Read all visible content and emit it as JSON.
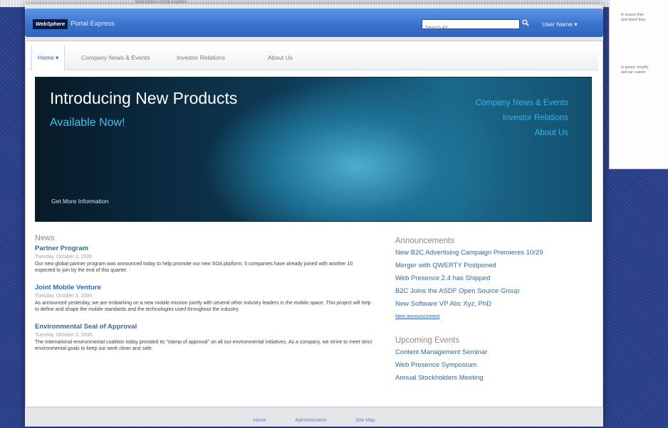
{
  "portal": {
    "brand_logo": "WebSphere",
    "brand_name": "Portal Express",
    "search_placeholder": "Search All",
    "search_icon": "search-icon",
    "user_menu": "User Name ▾"
  },
  "nav": {
    "tabs": [
      {
        "label": "Home ▾"
      },
      {
        "label": "Company News & Events"
      },
      {
        "label": "Investor Relations"
      },
      {
        "label": "About Us"
      }
    ]
  },
  "hero": {
    "title": "Introducing New Products",
    "subtitle": "Available Now!",
    "links": [
      "Company News & Events",
      "Investor Relations",
      "About Us"
    ],
    "cta": "Get More Information"
  },
  "news": {
    "title": "News",
    "items": [
      {
        "headline": "Partner Program",
        "date": "Tuesday, October 3, 2006",
        "body": "Our new global partner program was announced today to help promote our new SOA platform. 5 companies have already joined with another 10 expected to join by the end of this quarter."
      },
      {
        "headline": "Joint Mobile Venture",
        "date": "Tuesday, October 3, 2006",
        "body": "As announced yesterday, we are embarking on a new mobile mission jointly with several other industry leaders in the mobile space. This project will help to define and shape the mobile standards and the technologies used throughout the industry."
      },
      {
        "headline": "Environmental Seal of Approval",
        "date": "Tuesday, October 3, 2006",
        "body": "The international environmental coalition today provided its \"stamp of approval\" on all our environmental initiatives. As a company, we strive to meet strict environmental goals to keep our work clean and safe."
      }
    ]
  },
  "announcements": {
    "title": "Announcements",
    "items": [
      "New B2C Advertising Campaign Premieres 10/29",
      "Merger with QWERTY Postponed",
      "Web Presence 2.4 has Shipped",
      "B2C Joins the ASDF Open Source Group",
      "New Software VP Abc Xyz, PhD"
    ],
    "more": "New announcement"
  },
  "events": {
    "title": "Upcoming Events",
    "items": [
      "Content Management Seminar",
      "Web Presence Symposium",
      "Annual Stockholders Meeting"
    ]
  },
  "footer": {
    "links": [
      "Home",
      "Administration",
      "Site Map"
    ]
  },
  "background": {
    "caption": "WebSphere Portal Express",
    "window_lines": [
      "to assess their",
      "and where they",
      "to speed, simplify",
      "and our custom"
    ]
  },
  "colors": {
    "accent": "#2d68c4",
    "header": "#3a74cf",
    "hero_highlight": "#3ec0f2"
  }
}
